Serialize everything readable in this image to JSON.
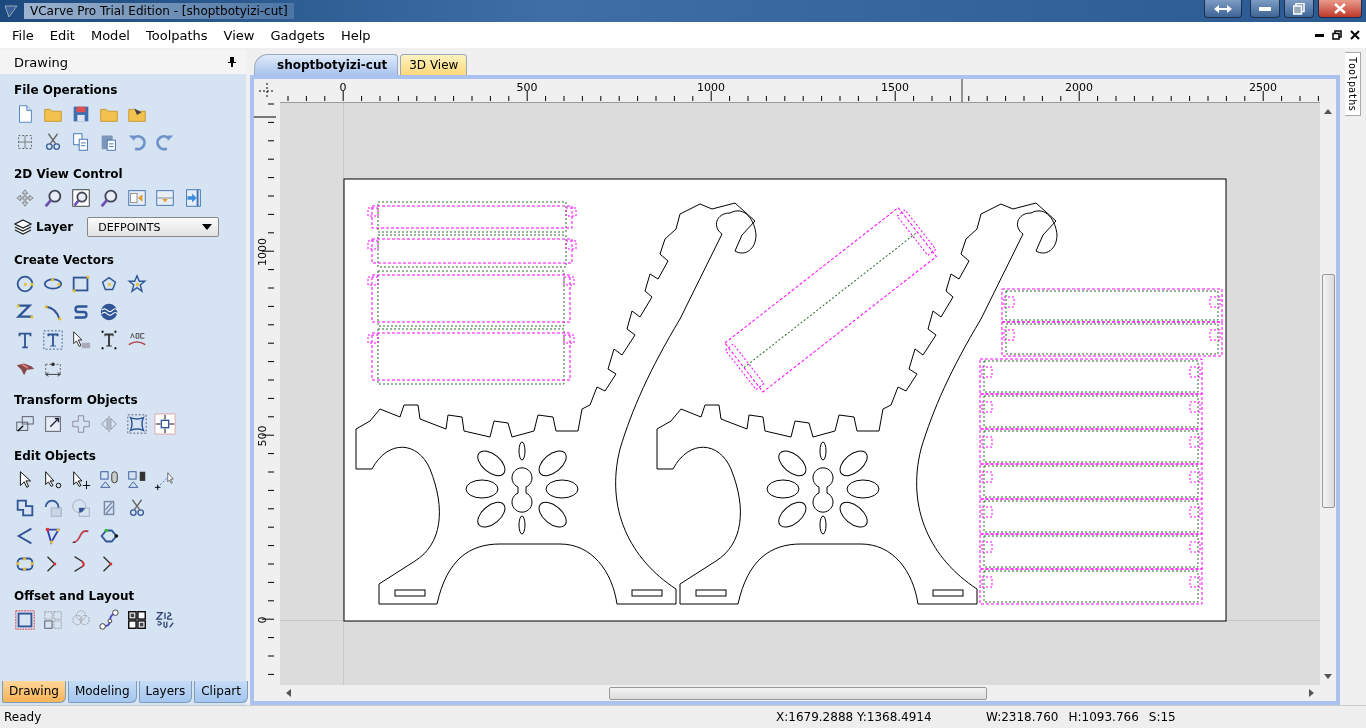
{
  "window": {
    "title": "VCarve Pro Trial Edition - [shoptbotyizi-cut]"
  },
  "menu": [
    "File",
    "Edit",
    "Model",
    "Toolpaths",
    "View",
    "Gadgets",
    "Help"
  ],
  "panel": {
    "title": "Drawing",
    "sections": [
      {
        "title": "File Operations"
      },
      {
        "title": "2D View Control",
        "layer": {
          "label": "Layer",
          "value": "DEFPOINTS"
        }
      },
      {
        "title": "Create Vectors"
      },
      {
        "title": "Transform Objects"
      },
      {
        "title": "Edit Objects"
      },
      {
        "title": "Offset and Layout"
      }
    ],
    "tabs": [
      {
        "label": "Drawing",
        "selected": true
      },
      {
        "label": "Modeling",
        "selected": false
      },
      {
        "label": "Layers",
        "selected": false
      },
      {
        "label": "Clipart",
        "selected": false
      }
    ]
  },
  "document_tabs": [
    {
      "label": "shoptbotyizi-cut",
      "selected": true
    },
    {
      "label": "3D View",
      "selected": false
    }
  ],
  "rulers": {
    "horizontal": [
      "0",
      "500",
      "1000",
      "1500",
      "2000",
      "2500"
    ],
    "vertical": [
      "1000",
      "500",
      "0"
    ]
  },
  "side_tab": "Toolpaths",
  "status_bar": {
    "message": "Ready",
    "cursor": "X:1679.2888 Y:1368.4914",
    "width": "W:2318.760",
    "height": "H:1093.766",
    "scale": "S:15"
  }
}
